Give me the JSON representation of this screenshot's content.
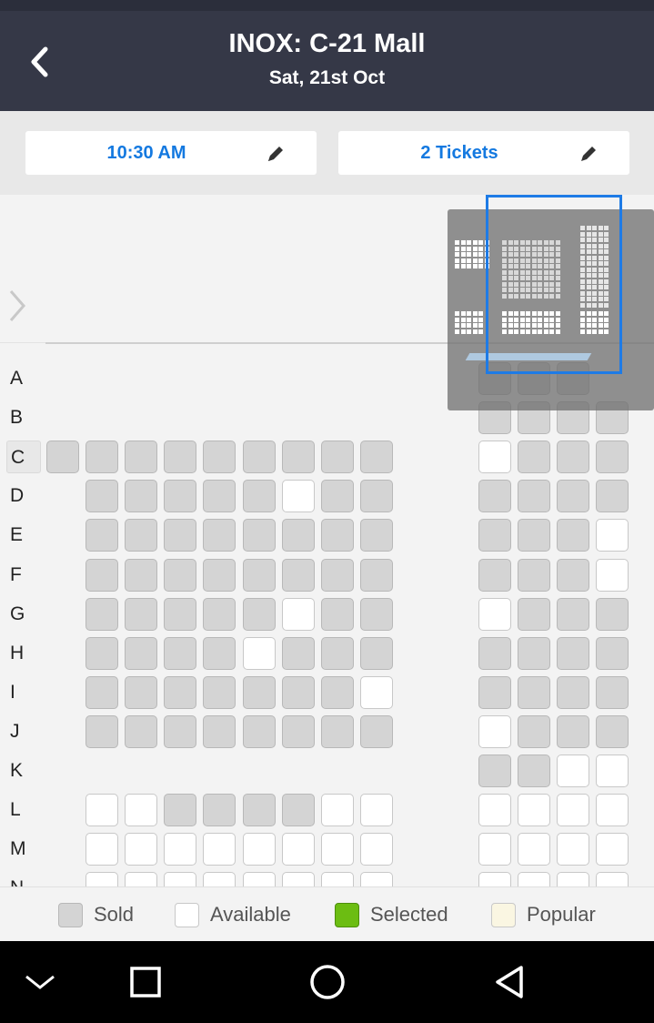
{
  "header": {
    "title": "INOX: C-21 Mall",
    "subtitle": "Sat, 21st Oct"
  },
  "toolbar": {
    "time_label": "10:30 AM",
    "tickets_label": "2 Tickets"
  },
  "rows": [
    {
      "label": "A",
      "highlighted": false,
      "left": [],
      "right": [
        "sold",
        "sold",
        "sold",
        ""
      ]
    },
    {
      "label": "B",
      "highlighted": false,
      "left": [],
      "right": [
        "sold",
        "sold",
        "sold",
        "sold"
      ]
    },
    {
      "label": "C",
      "highlighted": true,
      "left": [
        "sold",
        "sold",
        "sold",
        "sold",
        "sold",
        "sold",
        "sold",
        "sold",
        "sold"
      ],
      "right": [
        "avail",
        "sold",
        "sold",
        "sold"
      ]
    },
    {
      "label": "D",
      "highlighted": false,
      "left": [
        "",
        "sold",
        "sold",
        "sold",
        "sold",
        "sold",
        "avail",
        "sold",
        "sold"
      ],
      "right": [
        "sold",
        "sold",
        "sold",
        "sold"
      ]
    },
    {
      "label": "E",
      "highlighted": false,
      "left": [
        "",
        "sold",
        "sold",
        "sold",
        "sold",
        "sold",
        "sold",
        "sold",
        "sold"
      ],
      "right": [
        "sold",
        "sold",
        "sold",
        "avail"
      ]
    },
    {
      "label": "F",
      "highlighted": false,
      "left": [
        "",
        "sold",
        "sold",
        "sold",
        "sold",
        "sold",
        "sold",
        "sold",
        "sold"
      ],
      "right": [
        "sold",
        "sold",
        "sold",
        "avail"
      ]
    },
    {
      "label": "G",
      "highlighted": false,
      "left": [
        "",
        "sold",
        "sold",
        "sold",
        "sold",
        "sold",
        "avail",
        "sold",
        "sold"
      ],
      "right": [
        "avail",
        "sold",
        "sold",
        "sold"
      ]
    },
    {
      "label": "H",
      "highlighted": false,
      "left": [
        "",
        "sold",
        "sold",
        "sold",
        "sold",
        "avail",
        "sold",
        "sold",
        "sold"
      ],
      "right": [
        "sold",
        "sold",
        "sold",
        "sold"
      ]
    },
    {
      "label": "I",
      "highlighted": false,
      "left": [
        "",
        "sold",
        "sold",
        "sold",
        "sold",
        "sold",
        "sold",
        "sold",
        "avail"
      ],
      "right": [
        "sold",
        "sold",
        "sold",
        "sold"
      ]
    },
    {
      "label": "J",
      "highlighted": false,
      "left": [
        "",
        "sold",
        "sold",
        "sold",
        "sold",
        "sold",
        "sold",
        "sold",
        "sold"
      ],
      "right": [
        "avail",
        "sold",
        "sold",
        "sold"
      ]
    },
    {
      "label": "K",
      "highlighted": false,
      "left": [],
      "right": [
        "sold",
        "sold",
        "avail",
        "avail"
      ]
    },
    {
      "label": "L",
      "highlighted": false,
      "left": [
        "",
        "avail",
        "avail",
        "sold",
        "sold",
        "sold",
        "sold",
        "avail",
        "avail"
      ],
      "right": [
        "avail",
        "avail",
        "avail",
        "avail"
      ]
    },
    {
      "label": "M",
      "highlighted": false,
      "left": [
        "",
        "avail",
        "avail",
        "avail",
        "avail",
        "avail",
        "avail",
        "avail",
        "avail"
      ],
      "right": [
        "avail",
        "avail",
        "avail",
        "avail"
      ]
    },
    {
      "label": "N",
      "highlighted": false,
      "left": [
        "",
        "avail",
        "avail",
        "avail",
        "avail",
        "avail",
        "avail",
        "avail",
        "avail"
      ],
      "right": [
        "avail",
        "avail",
        "avail",
        "avail"
      ]
    }
  ],
  "legend": [
    {
      "label": "Sold",
      "color": "#d4d4d4"
    },
    {
      "label": "Available",
      "color": "#ffffff"
    },
    {
      "label": "Selected",
      "color": "#6cbd12"
    },
    {
      "label": "Popular",
      "color": "#faf6e2"
    }
  ],
  "colors": {
    "header_bg": "#353847",
    "accent": "#1479e0",
    "sold": "#d4d4d4",
    "available": "#ffffff",
    "minimap_viewport": "#1e7be6"
  },
  "icons": {
    "back": "chevron-left-icon",
    "edit": "pencil-icon",
    "scroll": "chevron-right-icon",
    "nav": [
      "chevron-down-icon",
      "square-icon",
      "circle-icon",
      "triangle-back-icon"
    ]
  }
}
